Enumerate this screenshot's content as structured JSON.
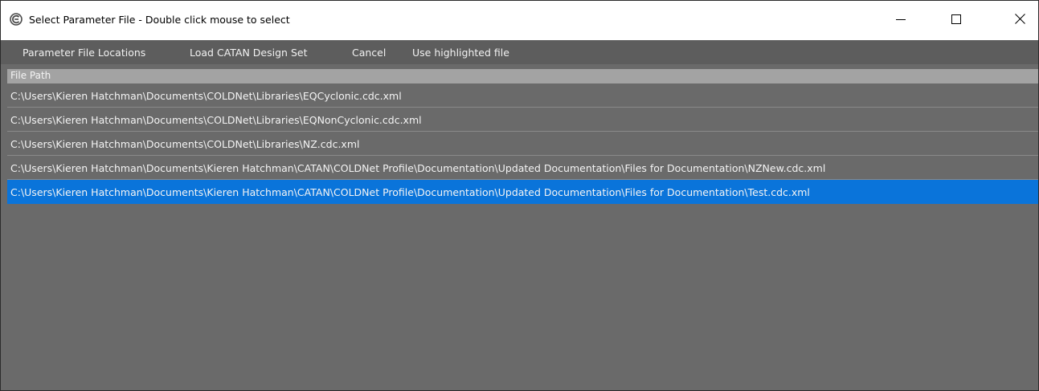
{
  "window": {
    "title": "Select Parameter File - Double click mouse to select",
    "icon": "app-c-icon",
    "controls": [
      "minimize-icon",
      "maximize-icon",
      "close-icon"
    ]
  },
  "menu": {
    "items": [
      {
        "label": "Parameter File Locations"
      },
      {
        "label": "Load CATAN Design Set"
      },
      {
        "label": "Cancel"
      },
      {
        "label": "Use highlighted file"
      }
    ]
  },
  "table": {
    "header": "File Path",
    "rows": [
      {
        "path": "C:\\Users\\Kieren Hatchman\\Documents\\COLDNet\\Libraries\\EQCyclonic.cdc.xml",
        "selected": false
      },
      {
        "path": "C:\\Users\\Kieren Hatchman\\Documents\\COLDNet\\Libraries\\EQNonCyclonic.cdc.xml",
        "selected": false
      },
      {
        "path": "C:\\Users\\Kieren Hatchman\\Documents\\COLDNet\\Libraries\\NZ.cdc.xml",
        "selected": false
      },
      {
        "path": "C:\\Users\\Kieren Hatchman\\Documents\\Kieren Hatchman\\CATAN\\COLDNet Profile\\Documentation\\Updated Documentation\\Files for Documentation\\NZNew.cdc.xml",
        "selected": false
      },
      {
        "path": "C:\\Users\\Kieren Hatchman\\Documents\\Kieren Hatchman\\CATAN\\COLDNet Profile\\Documentation\\Updated Documentation\\Files for Documentation\\Test.cdc.xml",
        "selected": true
      }
    ]
  },
  "colors": {
    "selected_row": "#0a74da",
    "background": "#6a6a6a",
    "menubar": "#5d5d5d",
    "header": "#a3a3a3"
  }
}
